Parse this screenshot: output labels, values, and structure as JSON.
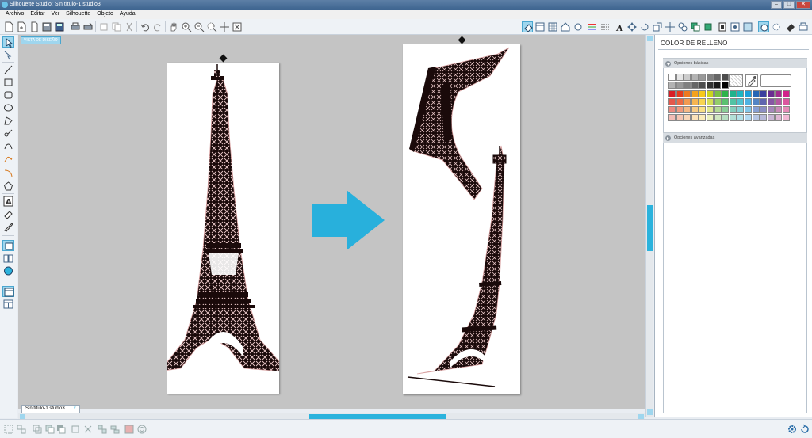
{
  "window": {
    "title": "Silhouette Studio: Sin título-1.studio3"
  },
  "menu": [
    "Archivo",
    "Editar",
    "Ver",
    "Silhouette",
    "Objeto",
    "Ayuda"
  ],
  "canvas": {
    "view_tag": "VISTA DE DISEÑO"
  },
  "document_tab": {
    "label": "Sin título-1.studio3"
  },
  "panel": {
    "title": "COLOR DE RELLENO",
    "basic_section": "Opciones básicas",
    "advanced_section": "Opciones avanzadas"
  },
  "colors": {
    "accent": "#2bb3dd",
    "arrow": "#28b0dc",
    "tower": "#1a0a0a",
    "tower_outline": "#d9a3a3",
    "gray_row": [
      "#ffffff",
      "#e6e6e6",
      "#cccccc",
      "#b3b3b3",
      "#999999",
      "#808080",
      "#666666",
      "#4d4d4d",
      "#333333",
      "#1a1a1a",
      "#000000"
    ],
    "palette": [
      [
        "#d81f26",
        "#e53b1d",
        "#ef7a1f",
        "#f4a21d",
        "#f6c81b",
        "#c9d41e",
        "#7ac142",
        "#2fb34a",
        "#1fb38c",
        "#1db5c0",
        "#1c9fd8",
        "#2566b5",
        "#3a3f9e",
        "#6a2d91",
        "#a02c8e",
        "#d2238a"
      ],
      [
        "#e4584c",
        "#ec6a46",
        "#f29a52",
        "#f6b551",
        "#f8d44f",
        "#d4de56",
        "#94cd6a",
        "#5cc170",
        "#52c3a4",
        "#50c3cf",
        "#4fb2e1",
        "#5485c5",
        "#6065b0",
        "#8757a5",
        "#b458a2",
        "#dc569f"
      ],
      [
        "#ec8a80",
        "#f09a7e",
        "#f5b886",
        "#f8cc86",
        "#fae185",
        "#e0e88b",
        "#b2d995",
        "#8acf98",
        "#85d0bd",
        "#84d1da",
        "#83c7ea",
        "#879fd4",
        "#8c8ec4",
        "#a587bb",
        "#c98ab8",
        "#e58ab7"
      ],
      [
        "#f3bcb5",
        "#f5c5b3",
        "#f9d6b8",
        "#fbe2b9",
        "#fcedb9",
        "#ebf1bd",
        "#cfe6c1",
        "#b6dfc2",
        "#b3e0d6",
        "#b3e1e8",
        "#b3daf2",
        "#b6c5e3",
        "#b9b9d9",
        "#c9b5d4",
        "#dfb7d3",
        "#f0b8d3"
      ]
    ]
  }
}
